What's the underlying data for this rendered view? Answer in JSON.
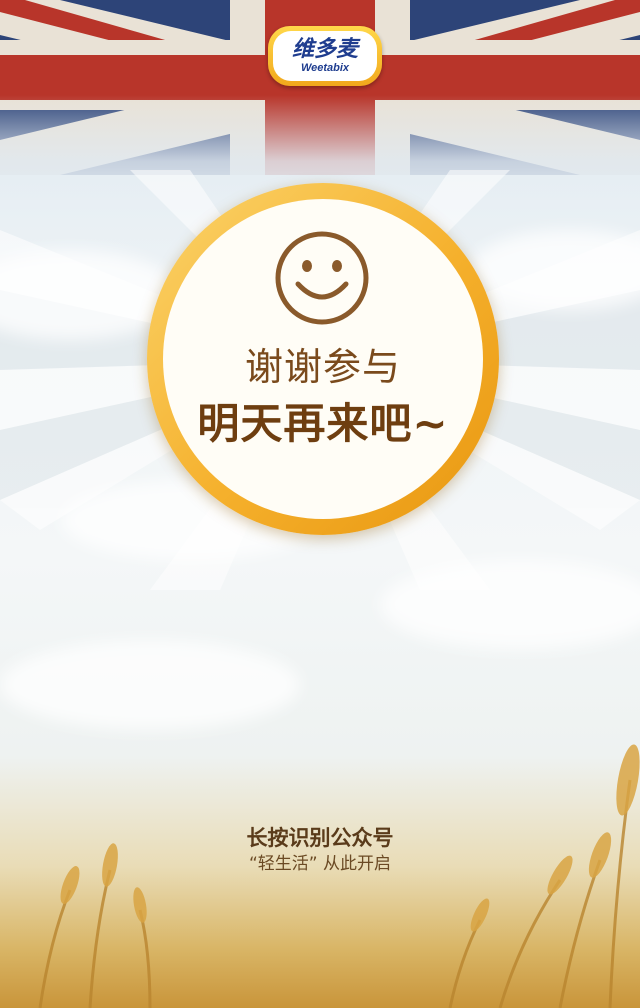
{
  "logo": {
    "brand_cn": "维多麦",
    "brand_en": "Weetabix"
  },
  "result": {
    "thanks": "谢谢参与",
    "tomorrow": "明天再来吧~"
  },
  "footer": {
    "title": "长按识别公众号",
    "subtitle": "“轻生活” 从此开启"
  },
  "colors": {
    "flag_blue": "#2a3f73",
    "flag_red": "#b8352a",
    "ring_gold": "#f5b02c",
    "text_brown": "#6e3e10"
  },
  "icons": [
    "smiley-face-icon"
  ]
}
